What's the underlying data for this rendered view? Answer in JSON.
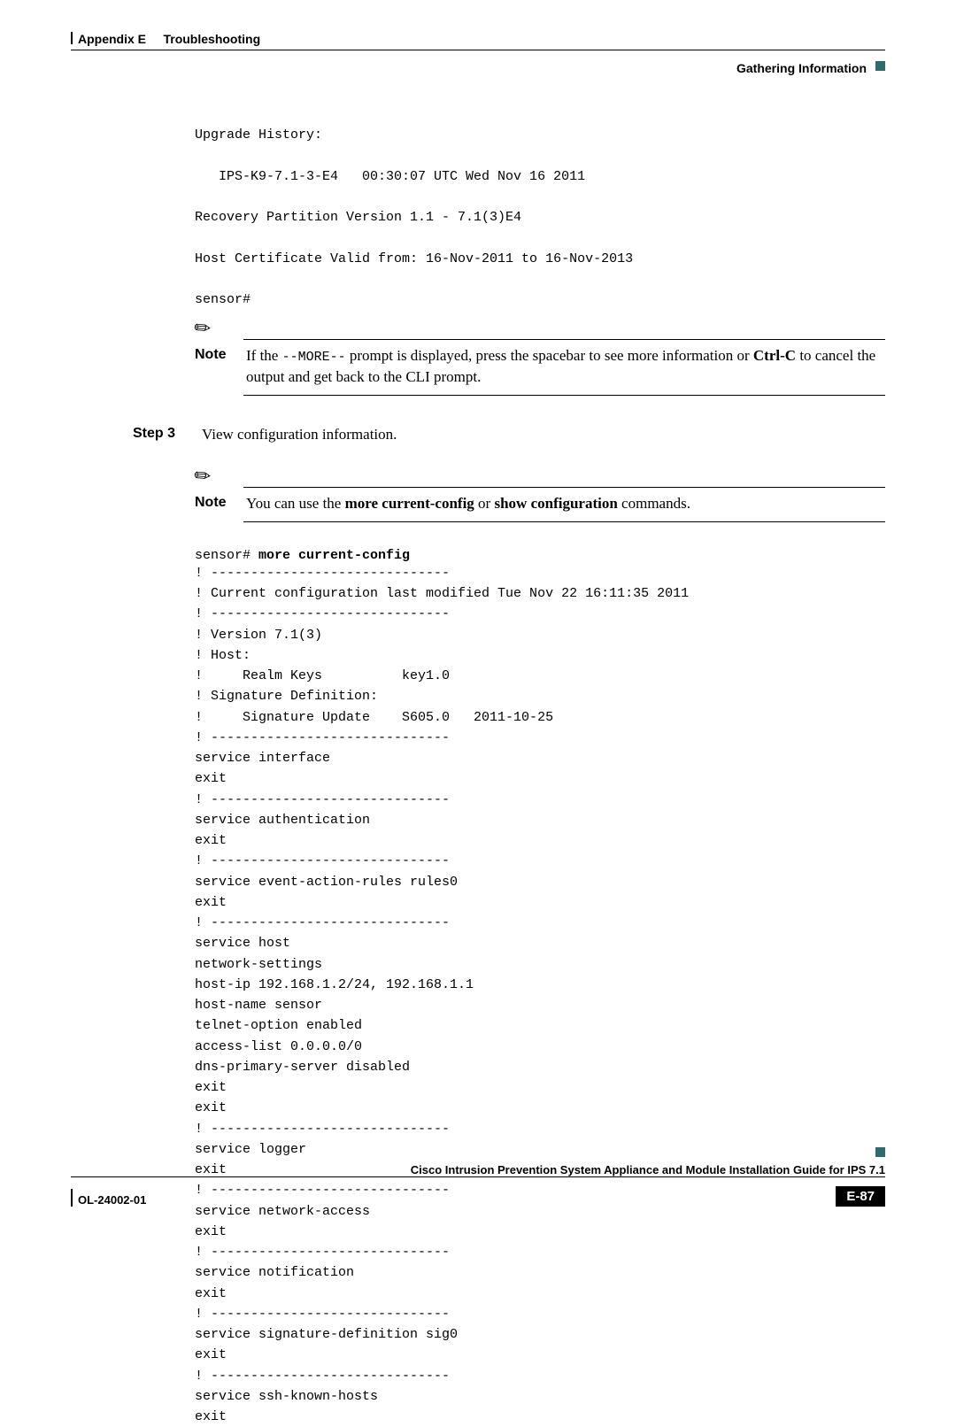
{
  "header": {
    "appendix": "Appendix E",
    "chapter": "Troubleshooting",
    "section": "Gathering Information"
  },
  "pre1": "Upgrade History:\n\n   IPS-K9-7.1-3-E4   00:30:07 UTC Wed Nov 16 2011\n\nRecovery Partition Version 1.1 - 7.1(3)E4\n\nHost Certificate Valid from: 16-Nov-2011 to 16-Nov-2013\n\nsensor#",
  "note1": {
    "label": "Note",
    "pre": "If the ",
    "mono": "--MORE--",
    "mid": " prompt is displayed, press the spacebar to see more information or ",
    "bold": "Ctrl-C",
    "post": " to cancel the output and get back to the CLI prompt."
  },
  "step": {
    "label": "Step 3",
    "text": "View configuration information."
  },
  "note2": {
    "label": "Note",
    "pre": "You can use the ",
    "b1": "more current-config",
    "mid": " or ",
    "b2": "show configuration",
    "post": " commands."
  },
  "cmd": {
    "prompt": "sensor# ",
    "command": "more current-config"
  },
  "pre2": "! ------------------------------\n! Current configuration last modified Tue Nov 22 16:11:35 2011\n! ------------------------------\n! Version 7.1(3)\n! Host:\n!     Realm Keys          key1.0\n! Signature Definition:\n!     Signature Update    S605.0   2011-10-25\n! ------------------------------\nservice interface\nexit\n! ------------------------------\nservice authentication\nexit\n! ------------------------------\nservice event-action-rules rules0\nexit\n! ------------------------------\nservice host\nnetwork-settings\nhost-ip 192.168.1.2/24, 192.168.1.1\nhost-name sensor\ntelnet-option enabled\naccess-list 0.0.0.0/0\ndns-primary-server disabled\nexit\nexit\n! ------------------------------\nservice logger\nexit\n! ------------------------------\nservice network-access\nexit\n! ------------------------------\nservice notification\nexit\n! ------------------------------\nservice signature-definition sig0\nexit\n! ------------------------------\nservice ssh-known-hosts\nexit",
  "footer": {
    "guide": "Cisco Intrusion Prevention System Appliance and Module Installation Guide for IPS 7.1",
    "bookid": "OL-24002-01",
    "page": "E-87"
  }
}
